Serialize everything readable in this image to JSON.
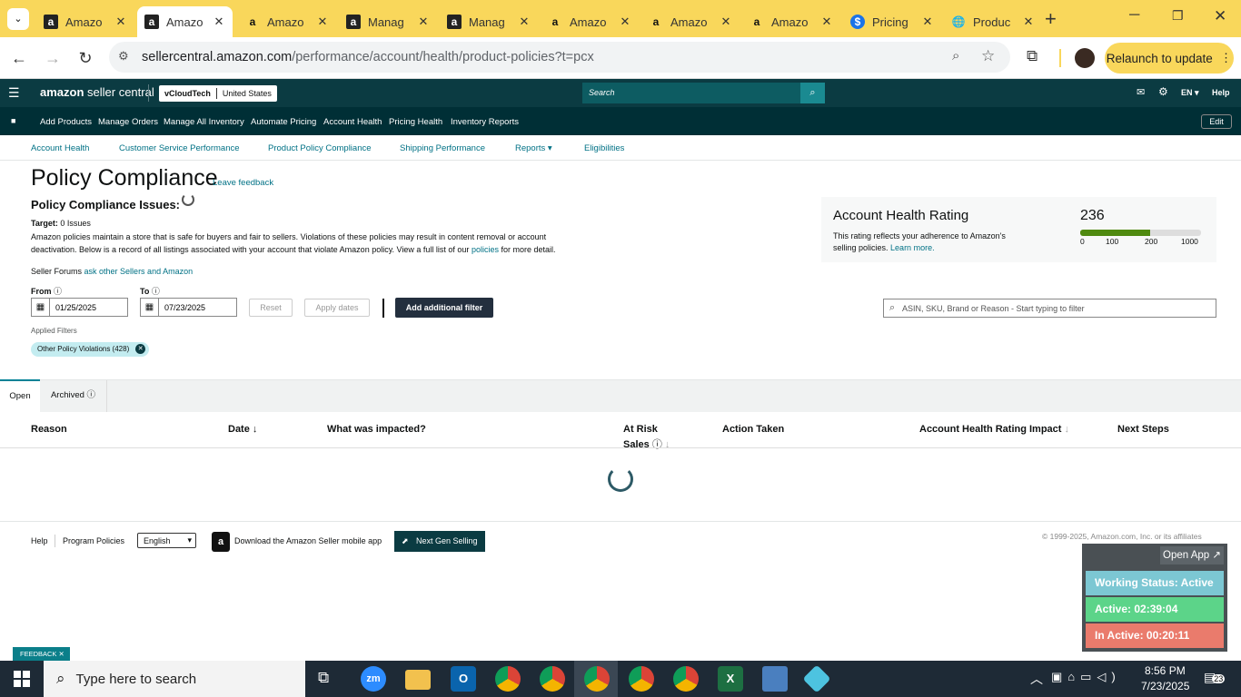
{
  "browser": {
    "tabs": [
      {
        "label": "Amazo",
        "icon": "amazon-a-icon"
      },
      {
        "label": "Amazo",
        "icon": "amazon-a-icon",
        "active": true
      },
      {
        "label": "Amazo",
        "icon": "amazon-smile-icon"
      },
      {
        "label": "Manag",
        "icon": "amazon-a-icon"
      },
      {
        "label": "Manag",
        "icon": "amazon-a-icon"
      },
      {
        "label": "Amazo",
        "icon": "amazon-smile-icon"
      },
      {
        "label": "Amazo",
        "icon": "amazon-smile-icon"
      },
      {
        "label": "Amazo",
        "icon": "amazon-smile-icon"
      },
      {
        "label": "Pricing",
        "icon": "dollar-icon"
      },
      {
        "label": "Produc",
        "icon": "globe-icon"
      }
    ],
    "url_host": "sellercentral.amazon.com",
    "url_path": "/performance/account/health/product-policies?t=pcx",
    "relaunch_label": "Relaunch to update"
  },
  "header": {
    "logo_bold": "amazon",
    "logo_rest": " seller central",
    "store_name": "vCloudTech",
    "marketplace": "United States",
    "search_placeholder": "Search",
    "lang": "EN",
    "help": "Help"
  },
  "menu": {
    "items": [
      "Add Products",
      "Manage Orders",
      "Manage All Inventory",
      "Automate Pricing",
      "Account Health",
      "Pricing Health",
      "Inventory Reports"
    ],
    "edit": "Edit"
  },
  "subnav": {
    "items": [
      "Account Health",
      "Customer Service Performance",
      "Product Policy Compliance",
      "Shipping Performance",
      "Reports",
      "Eligibilities"
    ]
  },
  "page": {
    "title": "Policy Compliance",
    "leave_feedback": "Leave feedback",
    "issues_heading": "Policy Compliance Issues:",
    "target_label": "Target:",
    "target_value": "0 Issues",
    "desc1": "Amazon policies maintain a store that is safe for buyers and fair to sellers. Violations of these policies may result in content removal or account",
    "desc2": "deactivation. Below is a record of all listings associated with your account that violate Amazon policy. View a full list of our",
    "desc_link": "policies",
    "desc3": "for more detail.",
    "forums_label": "Seller Forums",
    "forums_link": "ask other Sellers and Amazon",
    "from_label": "From",
    "to_label": "To",
    "from_date": "01/25/2025",
    "to_date": "07/23/2025",
    "reset": "Reset",
    "apply_dates": "Apply dates",
    "add_filter": "Add additional filter",
    "filter_placeholder": "ASIN, SKU, Brand or Reason - Start typing to filter",
    "applied_filters": "Applied Filters",
    "filter_chip": "Other Policy Violations (428)"
  },
  "ahr": {
    "title": "Account Health Rating",
    "desc1": "This rating reflects your adherence to Amazon's",
    "desc2": "selling policies.",
    "learn_more": "Learn more.",
    "score": "236",
    "scale": [
      "0",
      "100",
      "200",
      "1000"
    ],
    "score_color": "#4f8a10"
  },
  "table": {
    "tabs": [
      "Open",
      "Archived"
    ],
    "columns": [
      "Reason",
      "Date",
      "What was impacted?",
      "At Risk",
      "Sales",
      "Action Taken",
      "Account Health Rating Impact",
      "Next Steps"
    ]
  },
  "footer": {
    "help": "Help",
    "program_policies": "Program Policies",
    "language": "English",
    "download_app": "Download the Amazon Seller mobile app",
    "next_gen": "Next Gen Selling",
    "copyright": "© 1999-2025, Amazon.com, Inc. or its affiliates"
  },
  "widget": {
    "open_app": "Open App ↗",
    "working_status": "Working Status: Active",
    "active": "Active: 02:39:04",
    "inactive": "In Active: 00:20:11",
    "colors": {
      "status": "#7cc7d3",
      "active": "#5cd489",
      "inactive": "#ea7b6c"
    }
  },
  "feedback_tab": "FEEDBACK",
  "taskbar": {
    "search_placeholder": "Type here to search",
    "time": "8:56 PM",
    "date": "7/23/2025",
    "notifications": "23"
  }
}
